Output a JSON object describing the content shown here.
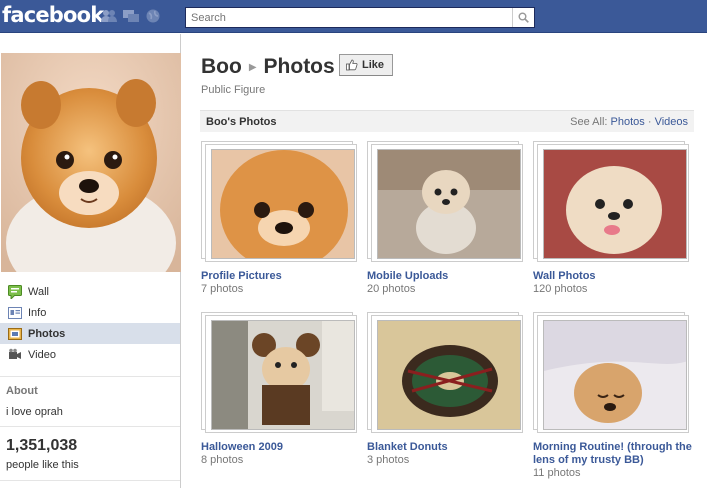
{
  "topbar": {
    "logo": "facebook",
    "search_placeholder": "Search"
  },
  "sidebar": {
    "nav": [
      {
        "label": "Wall",
        "icon": "wall-icon"
      },
      {
        "label": "Info",
        "icon": "info-icon"
      },
      {
        "label": "Photos",
        "icon": "photos-icon",
        "active": true
      },
      {
        "label": "Video",
        "icon": "video-icon"
      }
    ],
    "about_heading": "About",
    "about_text": "i love oprah",
    "likes_count": "1,351,038",
    "likes_text": "people like this"
  },
  "page": {
    "name": "Boo",
    "section": "Photos",
    "like_label": "Like",
    "category": "Public Figure"
  },
  "photos_section": {
    "heading": "Boo's Photos",
    "see_all": "See All:",
    "see_photos": "Photos",
    "dot": "·",
    "see_videos": "Videos"
  },
  "albums": [
    {
      "name": "Profile Pictures",
      "count": "7 photos"
    },
    {
      "name": "Mobile Uploads",
      "count": "20 photos"
    },
    {
      "name": "Wall Photos",
      "count": "120 photos"
    },
    {
      "name": "Halloween 2009",
      "count": "8 photos"
    },
    {
      "name": "Blanket Donuts",
      "count": "3 photos"
    },
    {
      "name": "Morning Routine! (through the lens of my trusty BB)",
      "count": "11 photos"
    }
  ],
  "colors": {
    "brand": "#3b5998",
    "nav_active": "#d8dfea"
  }
}
